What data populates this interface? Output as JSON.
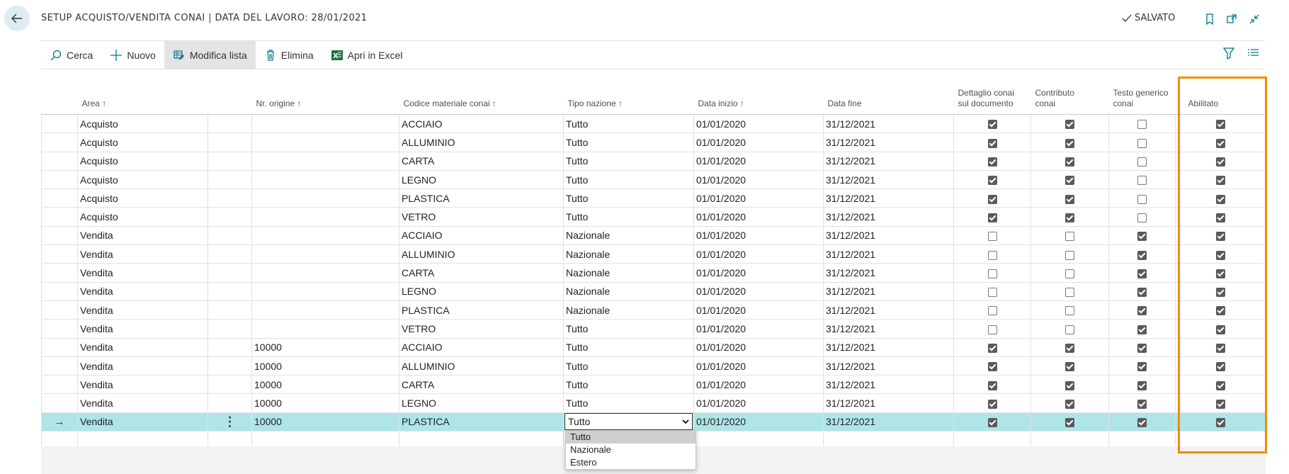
{
  "header": {
    "title": "SETUP ACQUISTO/VENDITA CONAI | DATA DEL LAVORO: 28/01/2021",
    "saved_label": "SALVATO"
  },
  "actions": {
    "search": "Cerca",
    "new": "Nuovo",
    "edit_list": "Modifica lista",
    "delete": "Elimina",
    "open_excel": "Apri in Excel"
  },
  "columns": {
    "area": "Area",
    "origin_no": "Nr. origine",
    "material_code": "Codice materiale conai",
    "nation_type": "Tipo nazione",
    "start_date": "Data inizio",
    "end_date": "Data fine",
    "detail_line1": "Dettaglio conai",
    "detail_line2": "sul documento",
    "contribution_line1": "Contributo",
    "contribution_line2": "conai",
    "text_line1": "Testo generico",
    "text_line2": "conai",
    "enabled": "Abilitato"
  },
  "rows": [
    {
      "area": "Acquisto",
      "origin": "",
      "material": "ACCIAIO",
      "nation": "Tutto",
      "start": "01/01/2020",
      "end": "31/12/2021",
      "detail": true,
      "contribution": true,
      "text": false,
      "enabled": true
    },
    {
      "area": "Acquisto",
      "origin": "",
      "material": "ALLUMINIO",
      "nation": "Tutto",
      "start": "01/01/2020",
      "end": "31/12/2021",
      "detail": true,
      "contribution": true,
      "text": false,
      "enabled": true
    },
    {
      "area": "Acquisto",
      "origin": "",
      "material": "CARTA",
      "nation": "Tutto",
      "start": "01/01/2020",
      "end": "31/12/2021",
      "detail": true,
      "contribution": true,
      "text": false,
      "enabled": true
    },
    {
      "area": "Acquisto",
      "origin": "",
      "material": "LEGNO",
      "nation": "Tutto",
      "start": "01/01/2020",
      "end": "31/12/2021",
      "detail": true,
      "contribution": true,
      "text": false,
      "enabled": true
    },
    {
      "area": "Acquisto",
      "origin": "",
      "material": "PLASTICA",
      "nation": "Tutto",
      "start": "01/01/2020",
      "end": "31/12/2021",
      "detail": true,
      "contribution": true,
      "text": false,
      "enabled": true
    },
    {
      "area": "Acquisto",
      "origin": "",
      "material": "VETRO",
      "nation": "Tutto",
      "start": "01/01/2020",
      "end": "31/12/2021",
      "detail": true,
      "contribution": true,
      "text": false,
      "enabled": true
    },
    {
      "area": "Vendita",
      "origin": "",
      "material": "ACCIAIO",
      "nation": "Nazionale",
      "start": "01/01/2020",
      "end": "31/12/2021",
      "detail": false,
      "contribution": false,
      "text": true,
      "enabled": true
    },
    {
      "area": "Vendita",
      "origin": "",
      "material": "ALLUMINIO",
      "nation": "Nazionale",
      "start": "01/01/2020",
      "end": "31/12/2021",
      "detail": false,
      "contribution": false,
      "text": true,
      "enabled": true
    },
    {
      "area": "Vendita",
      "origin": "",
      "material": "CARTA",
      "nation": "Nazionale",
      "start": "01/01/2020",
      "end": "31/12/2021",
      "detail": false,
      "contribution": false,
      "text": true,
      "enabled": true
    },
    {
      "area": "Vendita",
      "origin": "",
      "material": "LEGNO",
      "nation": "Nazionale",
      "start": "01/01/2020",
      "end": "31/12/2021",
      "detail": false,
      "contribution": false,
      "text": true,
      "enabled": true
    },
    {
      "area": "Vendita",
      "origin": "",
      "material": "PLASTICA",
      "nation": "Nazionale",
      "start": "01/01/2020",
      "end": "31/12/2021",
      "detail": false,
      "contribution": false,
      "text": true,
      "enabled": true
    },
    {
      "area": "Vendita",
      "origin": "",
      "material": "VETRO",
      "nation": "Tutto",
      "start": "01/01/2020",
      "end": "31/12/2021",
      "detail": false,
      "contribution": false,
      "text": true,
      "enabled": true
    },
    {
      "area": "Vendita",
      "origin": "10000",
      "material": "ACCIAIO",
      "nation": "Tutto",
      "start": "01/01/2020",
      "end": "31/12/2021",
      "detail": true,
      "contribution": true,
      "text": true,
      "enabled": true
    },
    {
      "area": "Vendita",
      "origin": "10000",
      "material": "ALLUMINIO",
      "nation": "Tutto",
      "start": "01/01/2020",
      "end": "31/12/2021",
      "detail": true,
      "contribution": true,
      "text": true,
      "enabled": true
    },
    {
      "area": "Vendita",
      "origin": "10000",
      "material": "CARTA",
      "nation": "Tutto",
      "start": "01/01/2020",
      "end": "31/12/2021",
      "detail": true,
      "contribution": true,
      "text": true,
      "enabled": true
    },
    {
      "area": "Vendita",
      "origin": "10000",
      "material": "LEGNO",
      "nation": "Tutto",
      "start": "01/01/2020",
      "end": "31/12/2021",
      "detail": true,
      "contribution": true,
      "text": true,
      "enabled": true
    },
    {
      "area": "Vendita",
      "origin": "10000",
      "material": "PLASTICA",
      "nation": "Tutto",
      "start": "01/01/2020",
      "end": "31/12/2021",
      "detail": true,
      "contribution": true,
      "text": true,
      "enabled": true,
      "selected": true
    }
  ],
  "dropdown": {
    "current": "Tutto",
    "options": [
      "Tutto",
      "Nazionale",
      "Estero"
    ]
  },
  "colors": {
    "selected_row": "#b0e5e8",
    "highlight_border": "#f28b00",
    "excel_green": "#1d6f42",
    "accent_teal": "#00758f"
  }
}
